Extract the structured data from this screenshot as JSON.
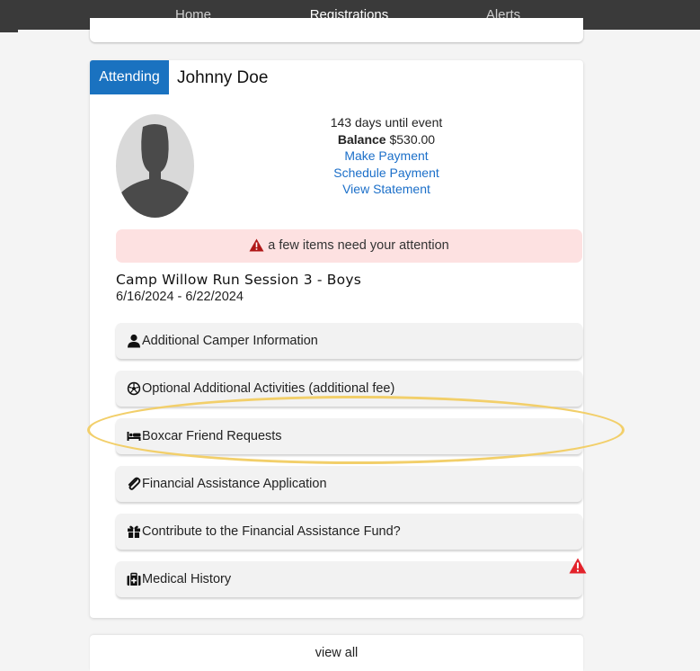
{
  "nav": {
    "tabs": [
      {
        "label": "Home"
      },
      {
        "label": "Registrations"
      },
      {
        "label": "Alerts"
      }
    ],
    "active": "Registrations"
  },
  "registration": {
    "status": "Attending",
    "camper_name": "Johnny Doe",
    "days_until": "143 days until event",
    "balance_label": "Balance",
    "balance_value": "$530.00",
    "links": {
      "make_payment": "Make Payment",
      "schedule_payment": "Schedule Payment",
      "view_statement": "View Statement"
    },
    "alert": {
      "text": "a few items need your attention",
      "icon": "warning-triangle-icon",
      "color": "#b01818"
    },
    "session": {
      "title": "Camp Willow Run Session 3 - Boys",
      "dates": "6/16/2024 - 6/22/2024"
    },
    "items": [
      {
        "label": "Additional Camper Information",
        "icon": "user-icon"
      },
      {
        "label": "Optional Additional Activities (additional fee)",
        "icon": "soccer-ball-icon"
      },
      {
        "label": "Boxcar Friend Requests",
        "icon": "bed-icon"
      },
      {
        "label": "Financial Assistance Application",
        "icon": "paperclip-icon"
      },
      {
        "label": "Contribute to the Financial Assistance Fund?",
        "icon": "gift-icon"
      },
      {
        "label": "Medical History",
        "icon": "medical-kit-icon",
        "warning": true
      }
    ],
    "highlighted_item": "Boxcar Friend Requests"
  },
  "footer": {
    "view_all": "view all"
  },
  "colors": {
    "nav_bg": "#3a3a3a",
    "accent_blue": "#1a72c0",
    "link_blue": "#1b6fc9",
    "alert_bg": "#fde1e1",
    "warning_red": "#e3232b",
    "highlight_ring": "#f2cf6a"
  }
}
